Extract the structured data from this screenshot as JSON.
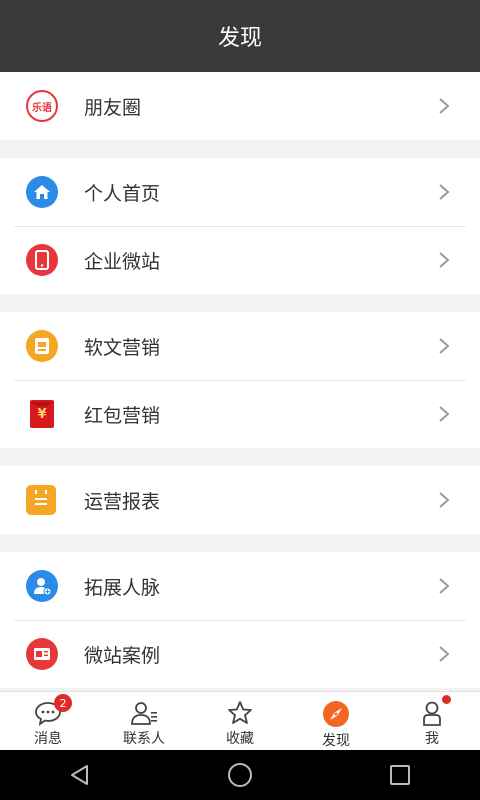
{
  "header": {
    "title": "发现"
  },
  "menu": {
    "moments": {
      "label": "朋友圈",
      "icon_text": "乐语"
    },
    "homepage": {
      "label": "个人首页"
    },
    "microsite": {
      "label": "企业微站"
    },
    "article_marketing": {
      "label": "软文营销"
    },
    "redpacket_marketing": {
      "label": "红包营销",
      "icon_text": "¥"
    },
    "operation_report": {
      "label": "运营报表"
    },
    "expand_contacts": {
      "label": "拓展人脉"
    },
    "microsite_cases": {
      "label": "微站案例"
    }
  },
  "tabs": {
    "messages": {
      "label": "消息",
      "badge": "2"
    },
    "contacts": {
      "label": "联系人"
    },
    "favorites": {
      "label": "收藏"
    },
    "discover": {
      "label": "发现"
    },
    "me": {
      "label": "我"
    }
  },
  "colors": {
    "header_bg": "#3a3a3a",
    "accent": "#f26522",
    "blue": "#2b8be6",
    "red": "#e8373a",
    "orange": "#f5a623",
    "badge": "#e02b2b"
  }
}
